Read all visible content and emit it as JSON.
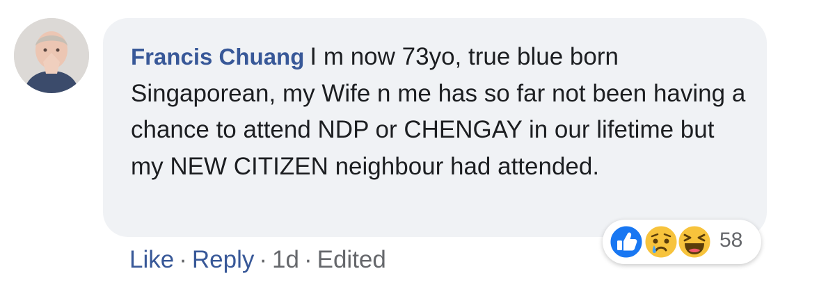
{
  "comment": {
    "author": "Francis Chuang",
    "text": "I m now 73yo, true blue born Singaporean, my Wife n me has so far not been having a chance to attend NDP or CHENGAY in our lifetime but my NEW CITIZEN neighbour had attended."
  },
  "reactions": {
    "icons": [
      "like-icon",
      "sad-icon",
      "haha-icon"
    ],
    "count": "58"
  },
  "actions": {
    "like_label": "Like",
    "separator": "·",
    "reply_label": "Reply",
    "time": "1d",
    "edited": "Edited"
  },
  "colors": {
    "author": "#385898",
    "bubble": "#f0f2f5",
    "text": "#1c1e21",
    "meta": "#65676b",
    "like_blue": "#1877f2"
  }
}
